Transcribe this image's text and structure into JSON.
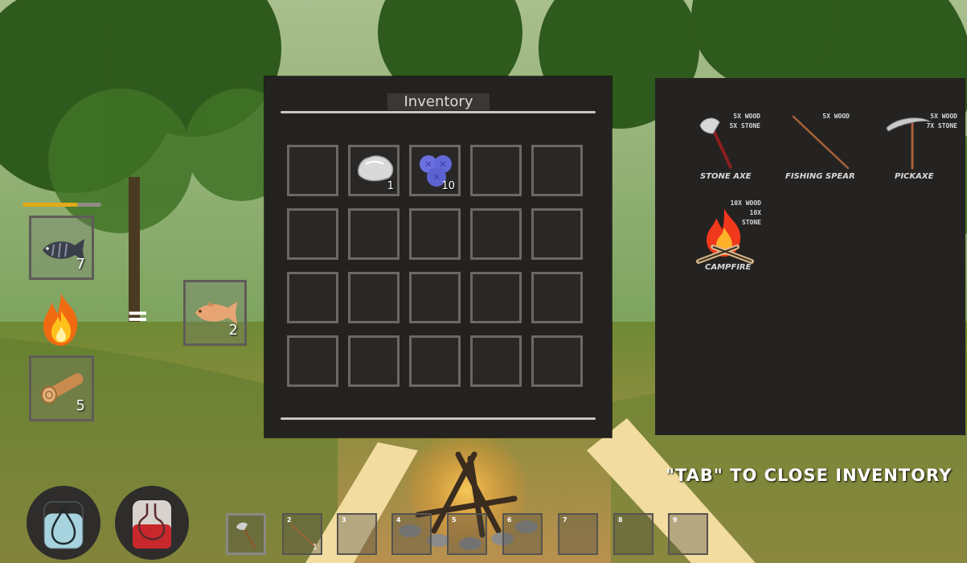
{
  "inventory": {
    "title": "Inventory",
    "slots": [
      {
        "item": "",
        "count": ""
      },
      {
        "item": "stone",
        "count": "1"
      },
      {
        "item": "blueberries",
        "count": "10"
      },
      {
        "item": "",
        "count": ""
      },
      {
        "item": "",
        "count": ""
      },
      {
        "item": "",
        "count": ""
      },
      {
        "item": "",
        "count": ""
      },
      {
        "item": "",
        "count": ""
      },
      {
        "item": "",
        "count": ""
      },
      {
        "item": "",
        "count": ""
      },
      {
        "item": "",
        "count": ""
      },
      {
        "item": "",
        "count": ""
      },
      {
        "item": "",
        "count": ""
      },
      {
        "item": "",
        "count": ""
      },
      {
        "item": "",
        "count": ""
      },
      {
        "item": "",
        "count": ""
      },
      {
        "item": "",
        "count": ""
      },
      {
        "item": "",
        "count": ""
      },
      {
        "item": "",
        "count": ""
      },
      {
        "item": "",
        "count": ""
      }
    ]
  },
  "crafting": {
    "recipes": [
      {
        "name": "STONE AXE",
        "cost": [
          "5X WOOD",
          "5X STONE"
        ],
        "icon": "stone-axe-icon"
      },
      {
        "name": "FISHING SPEAR",
        "cost": [
          "5X WOOD"
        ],
        "icon": "fishing-spear-icon"
      },
      {
        "name": "PICKAXE",
        "cost": [
          "5X WOOD",
          "7X STONE"
        ],
        "icon": "pickaxe-icon"
      },
      {
        "name": "CAMPFIRE",
        "cost": [
          "10X WOOD",
          "10X STONE"
        ],
        "icon": "campfire-icon"
      }
    ]
  },
  "cooking": {
    "progress": 0.7,
    "raw_fish_count": "7",
    "wood_count": "5",
    "cooked_fish_count": "2",
    "equals": "="
  },
  "hint": "\"TAB\" TO CLOSE INVENTORY",
  "hotbar": {
    "slots": [
      {
        "num": "",
        "item": "stone-axe",
        "count": ""
      },
      {
        "num": "2",
        "item": "fishing-spear",
        "count": "1"
      },
      {
        "num": "3",
        "item": "",
        "count": ""
      },
      {
        "num": "4",
        "item": "",
        "count": ""
      },
      {
        "num": "5",
        "item": "",
        "count": ""
      },
      {
        "num": "6",
        "item": "",
        "count": ""
      },
      {
        "num": "7",
        "item": "",
        "count": ""
      },
      {
        "num": "8",
        "item": "",
        "count": ""
      },
      {
        "num": "9",
        "item": "",
        "count": ""
      }
    ]
  },
  "status": {
    "water_level": 0.75,
    "food_level": 0.5
  },
  "colors": {
    "panel": "#242220",
    "slot_border": "#6b6966",
    "progress": "#e2a91a",
    "water": "#a6d3de",
    "food": "#c8282c"
  }
}
